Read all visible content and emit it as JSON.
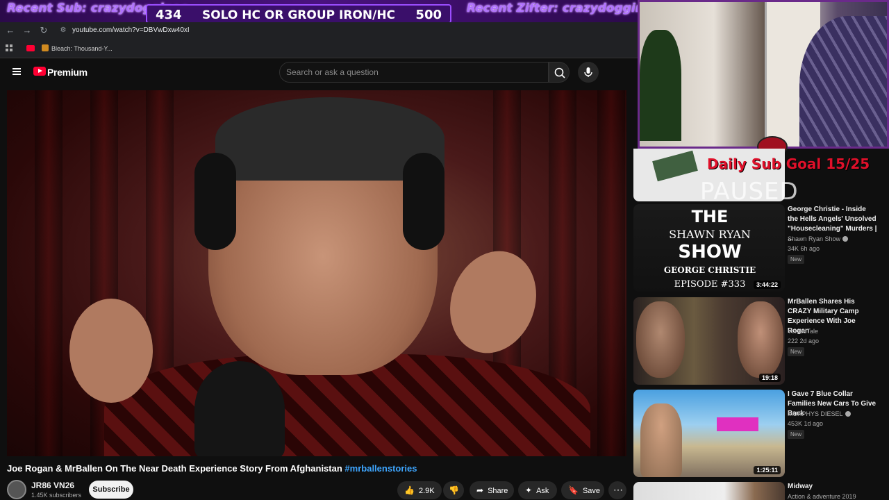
{
  "overlay": {
    "recent_sub": "Recent Sub: crazydogginoc",
    "goal_current": "434",
    "goal_text": "SOLO HC OR GROUP IRON/HC",
    "goal_target": "500",
    "recent_zifter": "Recent Zifter: crazydogginoc",
    "daily_sub_goal": "Daily Sub Goal 15/25",
    "paused_text": "PAUSED"
  },
  "browser": {
    "url": "youtube.com/watch?v=DBVwDxw40xI",
    "bookmark_label": "Bleach: Thousand-Y..."
  },
  "youtube": {
    "logo_text": "Premium",
    "search_placeholder": "Search or ask a question"
  },
  "video": {
    "title": "Joe Rogan & MrBallen On The Near Death Experience Story From Afghanistan",
    "hashtag": "#mrballenstories",
    "channel_name": "JR86 VN26",
    "channel_subs": "1.45K subscribers",
    "subscribe_label": "Subscribe",
    "likes": "2.9K",
    "share_label": "Share",
    "ask_label": "Ask",
    "save_label": "Save"
  },
  "recommendations": [
    {
      "title": "George Christie - Inside the Hells Angels' Unsolved \"Housecleaning\" Murders | ...",
      "channel": "Shawn Ryan Show",
      "meta": "34K  6h ago",
      "badge": "New",
      "duration": "3:44:22",
      "thumb_lines": [
        "THE",
        "SHAWN RYAN",
        "SHOW",
        "GEORGE CHRISTIE",
        "EPISODE #333"
      ]
    },
    {
      "title": "MrBallen Shares His CRAZY Military Camp Experience With Joe Rogan",
      "channel": "VoidedTale",
      "meta": "222  2d ago",
      "badge": "New",
      "duration": "19:18"
    },
    {
      "title": "I Gave 7 Blue Collar Families New Cars To Give Back",
      "channel": "MURPHYS DIESEL",
      "meta": "453K  1d ago",
      "badge": "New",
      "duration": "1:25:11"
    },
    {
      "title": "Midway",
      "channel": "Action & adventure 2019"
    }
  ]
}
